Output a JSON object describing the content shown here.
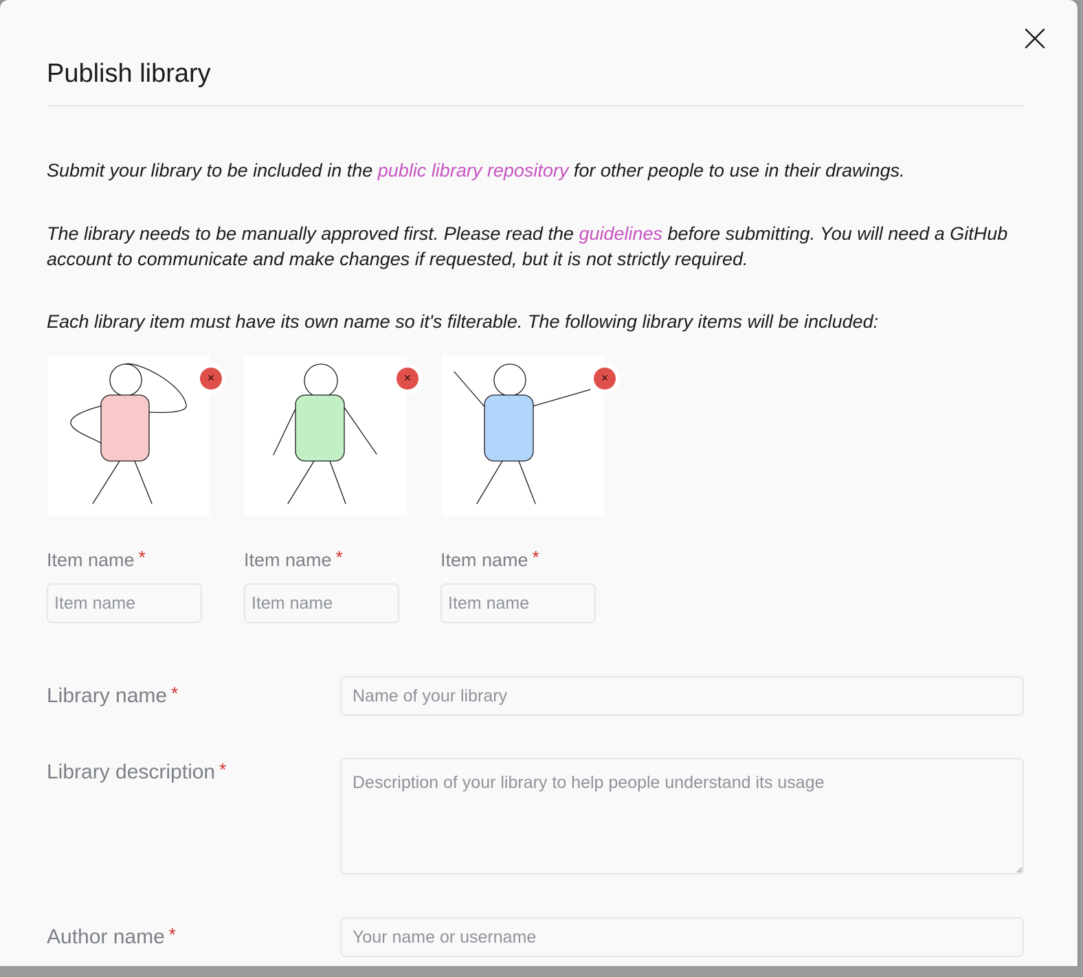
{
  "dialog": {
    "title": "Publish library",
    "close_icon": "close-icon"
  },
  "intro": {
    "p1_before": "Submit your library to be included in the ",
    "p1_link": "public library repository",
    "p1_after": " for other people to use in their drawings.",
    "p2_before": "The library needs to be manually approved first. Please read the ",
    "p2_link": "guidelines",
    "p2_after": " before submitting. You will need a GitHub account to communicate and make changes if requested, but it is not strictly required.",
    "p3": "Each library item must have its own name so it's filterable. The following library items will be included:"
  },
  "items": [
    {
      "label": "Item name",
      "required_mark": "*",
      "placeholder": "Item name",
      "value": "",
      "fill_color": "#f8c9c9",
      "remove_icon": "×"
    },
    {
      "label": "Item name",
      "required_mark": "*",
      "placeholder": "Item name",
      "value": "",
      "fill_color": "#c2efc4",
      "remove_icon": "×"
    },
    {
      "label": "Item name",
      "required_mark": "*",
      "placeholder": "Item name",
      "value": "",
      "fill_color": "#b2d6fb",
      "remove_icon": "×"
    }
  ],
  "form": {
    "library_name": {
      "label": "Library name",
      "required_mark": "*",
      "placeholder": "Name of your library",
      "value": ""
    },
    "library_description": {
      "label": "Library description",
      "required_mark": "*",
      "placeholder": "Description of your library to help people understand its usage",
      "value": ""
    },
    "author_name": {
      "label": "Author name",
      "required_mark": "*",
      "placeholder": "Your name or username",
      "value": ""
    }
  },
  "colors": {
    "link": "#c653c1",
    "required": "#d0302a",
    "remove_button": "#e0504a"
  }
}
